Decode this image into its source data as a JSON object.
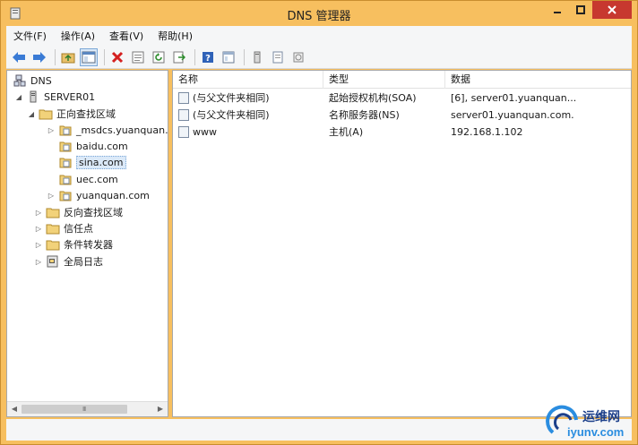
{
  "window": {
    "title": "DNS 管理器",
    "accent_color": "#f7bf5f",
    "close_color": "#c7382f"
  },
  "menu": {
    "items": [
      "文件(F)",
      "操作(A)",
      "查看(V)",
      "帮助(H)"
    ]
  },
  "toolbar": {
    "icons": [
      "back-arrow-icon",
      "forward-arrow-icon",
      "up-folder-icon",
      "show-hide-tree-icon",
      "delete-icon",
      "properties-icon",
      "refresh-icon",
      "export-list-icon",
      "help-icon",
      "console-view-icon",
      "server-icon",
      "zone-icon",
      "records-icon"
    ]
  },
  "tree": {
    "root": "DNS",
    "server": "SERVER01",
    "forward_zones": "正向查找区域",
    "zones": [
      "_msdcs.yuanquan.c",
      "baidu.com",
      "sina.com",
      "uec.com",
      "yuanquan.com"
    ],
    "selected_zone": "sina.com",
    "reverse_zones": "反向查找区域",
    "trust_points": "信任点",
    "conditional_forwarders": "条件转发器",
    "global_logs": "全局日志"
  },
  "scrollbar": {
    "grip": "III"
  },
  "list": {
    "columns": [
      "名称",
      "类型",
      "数据"
    ],
    "rows": [
      {
        "name": "(与父文件夹相同)",
        "type": "起始授权机构(SOA)",
        "data": "[6], server01.yuanquan...."
      },
      {
        "name": "(与父文件夹相同)",
        "type": "名称服务器(NS)",
        "data": "server01.yuanquan.com."
      },
      {
        "name": "www",
        "type": "主机(A)",
        "data": "192.168.1.102"
      }
    ]
  },
  "watermark": {
    "line1": "运维网",
    "line2": "iyunv.com"
  }
}
